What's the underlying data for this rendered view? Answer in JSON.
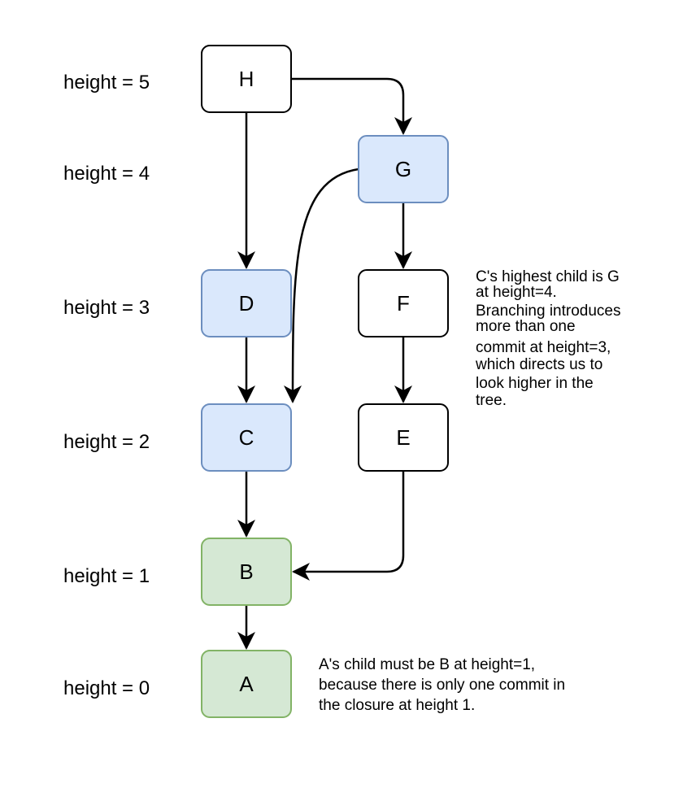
{
  "height_labels": [
    "height = 5",
    "height = 4",
    "height = 3",
    "height = 2",
    "height = 1",
    "height = 0"
  ],
  "nodes": {
    "H": "H",
    "G": "G",
    "D": "D",
    "F": "F",
    "C": "C",
    "E": "E",
    "B": "B",
    "A": "A"
  },
  "colors": {
    "blue_fill": "#dae8fc",
    "blue_stroke": "#6c8ebf",
    "green_fill": "#d5e8d4",
    "green_stroke": "#82b366",
    "plain_fill": "#ffffff",
    "plain_stroke": "#000000"
  },
  "notes": {
    "c_note": [
      "C's highest child is G",
      "at height=4.",
      "Branching introduces",
      "more than one",
      "commit at height=3,",
      "which directs us to",
      "look higher in the",
      "tree."
    ],
    "a_note": [
      "A's child must be B at height=1,",
      "because there is only one commit in",
      "the closure at height 1."
    ]
  }
}
